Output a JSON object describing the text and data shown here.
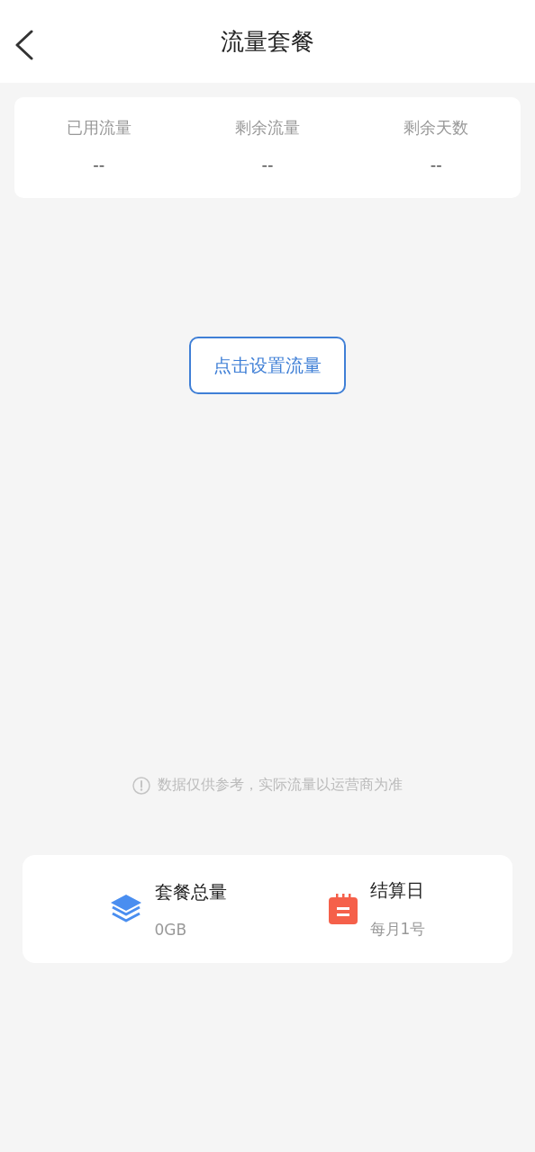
{
  "header": {
    "title": "流量套餐"
  },
  "stats": [
    {
      "label": "已用流量",
      "value": "--"
    },
    {
      "label": "剩余流量",
      "value": "--"
    },
    {
      "label": "剩余天数",
      "value": "--"
    }
  ],
  "setup_button": "点击设置流量",
  "notice": "数据仅供参考，实际流量以运营商为准",
  "summary": [
    {
      "kind": "layers",
      "title": "套餐总量",
      "value": "0GB"
    },
    {
      "kind": "calendar",
      "title": "结算日",
      "value": "每月1号"
    }
  ]
}
